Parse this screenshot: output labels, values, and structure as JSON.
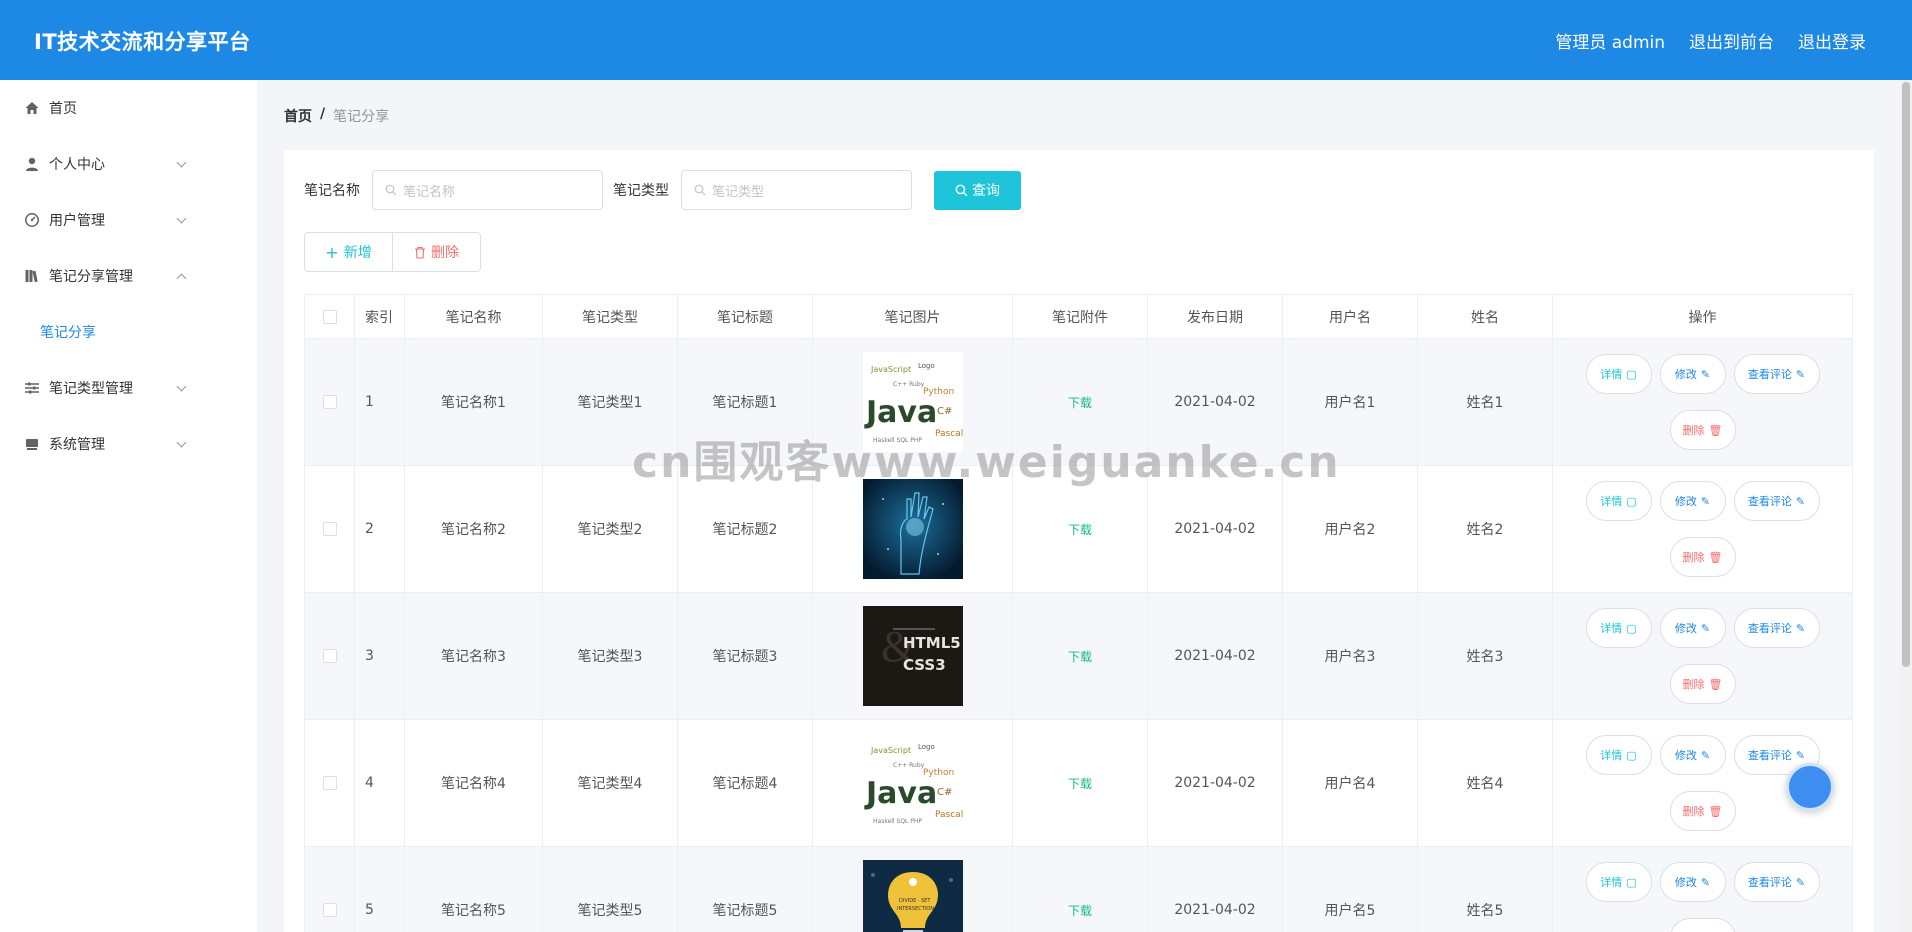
{
  "header": {
    "title": "IT技术交流和分享平台",
    "user": "管理员 admin",
    "front": "退出到前台",
    "logout": "退出登录"
  },
  "sidebar": {
    "items": [
      {
        "label": "首页",
        "icon": "home-icon"
      },
      {
        "label": "个人中心",
        "icon": "user-icon"
      },
      {
        "label": "用户管理",
        "icon": "gauge-icon"
      },
      {
        "label": "笔记分享管理",
        "icon": "library-icon"
      },
      {
        "label": "笔记类型管理",
        "icon": "sliders-icon"
      },
      {
        "label": "系统管理",
        "icon": "drive-icon"
      }
    ],
    "sub_item": "笔记分享"
  },
  "breadcrumb": {
    "home": "首页",
    "sep": "/",
    "current": "笔记分享"
  },
  "search": {
    "name_label": "笔记名称",
    "name_placeholder": "笔记名称",
    "type_label": "笔记类型",
    "type_placeholder": "笔记类型",
    "button": "查询"
  },
  "actions": {
    "add": "新增",
    "delete": "删除"
  },
  "table": {
    "headers": {
      "index": "索引",
      "name": "笔记名称",
      "type": "笔记类型",
      "title": "笔记标题",
      "image": "笔记图片",
      "attachment": "笔记附件",
      "date": "发布日期",
      "username": "用户名",
      "realname": "姓名",
      "ops": "操作"
    },
    "op_labels": {
      "detail": "详情",
      "edit": "修改",
      "comment": "查看评论",
      "delete": "删除"
    },
    "download": "下载",
    "rows": [
      {
        "index": "1",
        "name": "笔记名称1",
        "type": "笔记类型1",
        "title": "笔记标题1",
        "date": "2021-04-02",
        "username": "用户名1",
        "realname": "姓名1"
      },
      {
        "index": "2",
        "name": "笔记名称2",
        "type": "笔记类型2",
        "title": "笔记标题2",
        "date": "2021-04-02",
        "username": "用户名2",
        "realname": "姓名2"
      },
      {
        "index": "3",
        "name": "笔记名称3",
        "type": "笔记类型3",
        "title": "笔记标题3",
        "date": "2021-04-02",
        "username": "用户名3",
        "realname": "姓名3"
      },
      {
        "index": "4",
        "name": "笔记名称4",
        "type": "笔记类型4",
        "title": "笔记标题4",
        "date": "2021-04-02",
        "username": "用户名4",
        "realname": "姓名4"
      },
      {
        "index": "5",
        "name": "笔记名称5",
        "type": "笔记类型5",
        "title": "笔记标题5",
        "date": "2021-04-02",
        "username": "用户名5",
        "realname": "姓名5"
      }
    ],
    "thumb_texts": {
      "java": "Java",
      "html": "HTML5",
      "css": "CSS3"
    }
  },
  "watermark": "cn围观客www.weiguanke.cn",
  "colors": {
    "primary": "#1e88e5",
    "accent": "#1ec4d9",
    "danger": "#f56c6c",
    "success": "#13b88c"
  }
}
